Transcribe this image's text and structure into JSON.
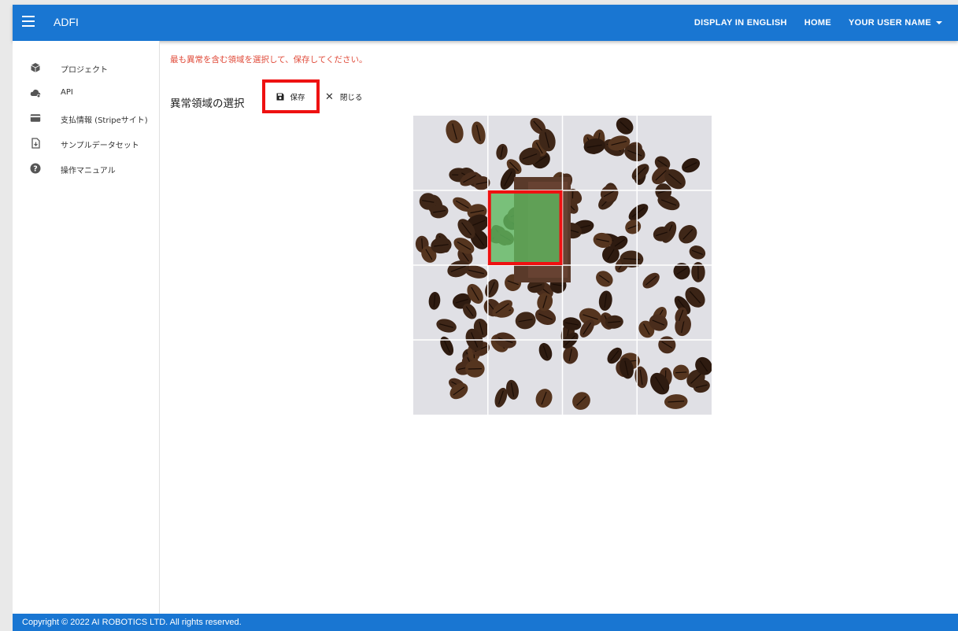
{
  "app": {
    "title": "ADFI"
  },
  "header": {
    "actions": [
      {
        "label": "DISPLAY IN ENGLISH"
      },
      {
        "label": "HOME"
      },
      {
        "label": "YOUR USER NAME"
      }
    ]
  },
  "sidebar": {
    "items": [
      {
        "label": "プロジェクト",
        "icon": "cube-icon"
      },
      {
        "label": "API",
        "icon": "cloud-icon"
      },
      {
        "label": "支払情報 (Stripeサイト)",
        "icon": "credit-card-icon"
      },
      {
        "label": "サンプルデータセット",
        "icon": "file-download-icon"
      },
      {
        "label": "操作マニュアル",
        "icon": "help-circle-icon"
      }
    ]
  },
  "main": {
    "instruction": "最も異常を含む領域を選択して、保存してください。",
    "section_title": "異常領域の選択",
    "save_label": "保存",
    "close_label": "閉じる",
    "grid": {
      "rows": 4,
      "cols": 4,
      "selected_cell": {
        "row": 2,
        "col": 2
      }
    }
  },
  "footer": {
    "copyright": "Copyright © 2022 AI ROBOTICS LTD. All rights reserved."
  },
  "colors": {
    "primary": "#1976d2",
    "instruction": "#e04b3a",
    "highlight": "#ee1111",
    "selection_fill": "#5fb85f"
  }
}
